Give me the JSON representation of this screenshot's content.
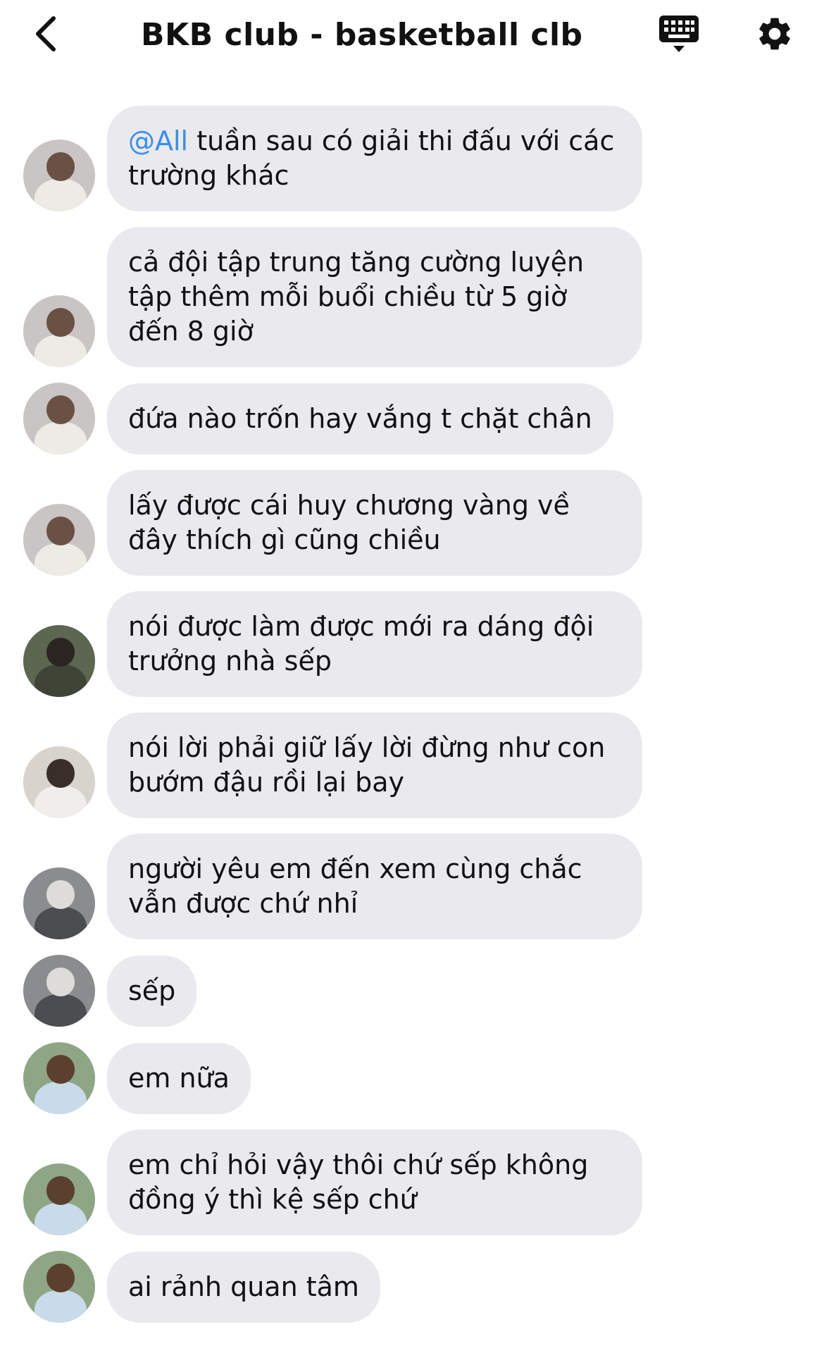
{
  "header": {
    "title": "BKB club - basketball clb",
    "icons": {
      "back": "chevron-left-icon",
      "keyboard": "keyboard-icon",
      "settings": "gear-icon"
    }
  },
  "colors": {
    "bubble_bg": "#e9e9ee",
    "mention": "#3a8ee6",
    "text": "#111111",
    "background": "#ffffff"
  },
  "messages": [
    {
      "avatar": "a",
      "mention": "@All",
      "text": " tuần sau có giải thi đấu với các trường khác"
    },
    {
      "avatar": "a",
      "text": "cả đội tập trung tăng cường luyện tập thêm mỗi buổi chiều từ 5 giờ đến 8 giờ"
    },
    {
      "avatar": "a",
      "text": "đứa nào trốn hay vắng t chặt chân"
    },
    {
      "avatar": "a",
      "text": "lấy được cái huy chương vàng về đây thích gì cũng chiều"
    },
    {
      "avatar": "b",
      "text": "nói được làm được mới ra dáng đội trưởng nhà sếp"
    },
    {
      "avatar": "c",
      "text": "nói lời phải giữ lấy lời đừng như con bướm đậu rồi lại bay"
    },
    {
      "avatar": "d",
      "text": "người yêu em đến xem cùng chắc vẫn được chứ nhỉ"
    },
    {
      "avatar": "d",
      "text": "sếp"
    },
    {
      "avatar": "e",
      "text": "em nữa"
    },
    {
      "avatar": "e",
      "text": "em chỉ hỏi vậy thôi chứ sếp không đồng ý thì kệ sếp chứ"
    },
    {
      "avatar": "e",
      "text": "ai rảnh quan tâm"
    }
  ]
}
